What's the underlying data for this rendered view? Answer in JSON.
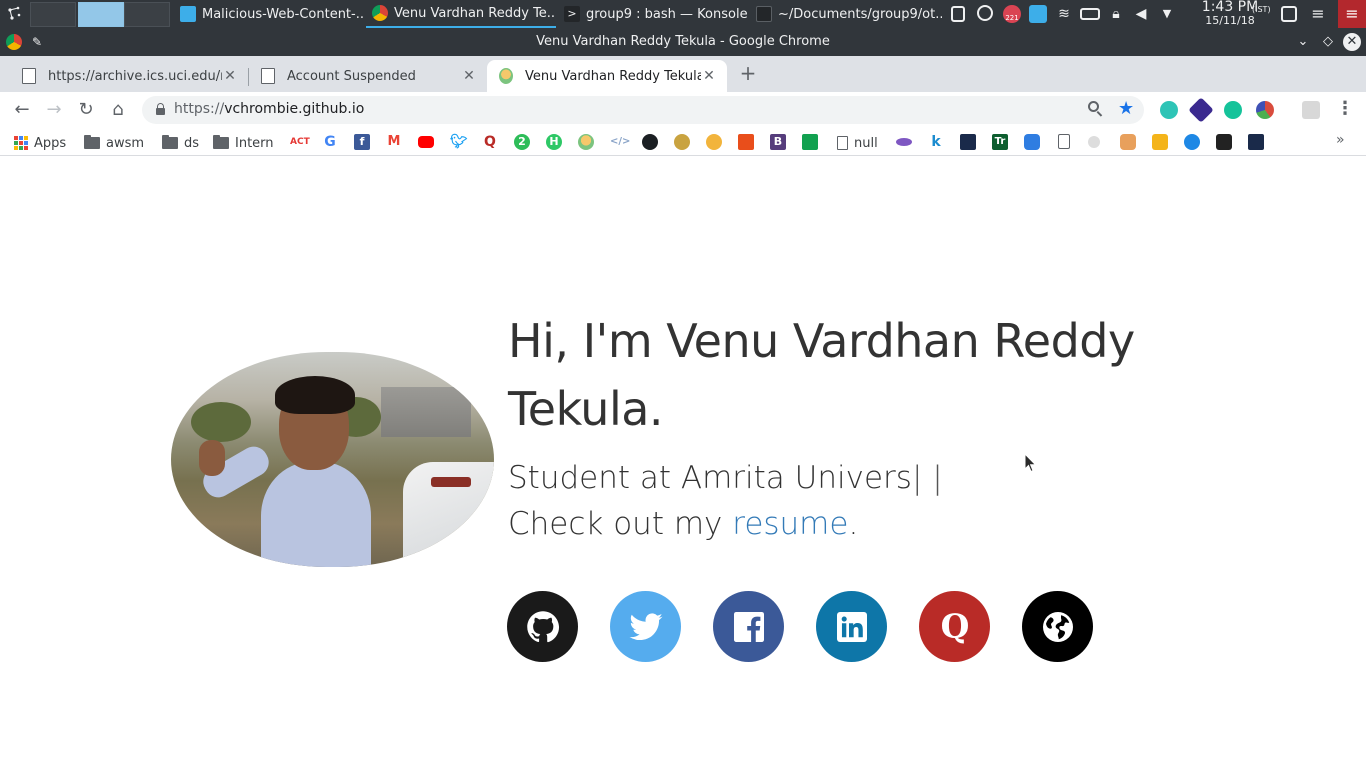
{
  "taskbar": {
    "tasks": [
      {
        "label": "Malicious-Web-Content-...",
        "icon": "folder-icon",
        "active": false
      },
      {
        "label": "Venu Vardhan Reddy Te...",
        "icon": "chrome-icon",
        "active": true
      },
      {
        "label": "group9 : bash — Konsole",
        "icon": "terminal-icon",
        "active": false
      },
      {
        "label": "~/Documents/group9/ot...",
        "icon": "editor-icon",
        "active": false
      }
    ],
    "clock": {
      "time": "1:43 PM",
      "zone": "(IST)",
      "date": "15/11/18"
    },
    "tray_badge": "221"
  },
  "window": {
    "title": "Venu Vardhan Reddy Tekula - Google Chrome"
  },
  "tabs": [
    {
      "label": "https://archive.ics.uci.edu/ml/...",
      "active": false
    },
    {
      "label": "Account Suspended",
      "active": false
    },
    {
      "label": "Venu Vardhan Reddy Tekula",
      "active": true
    }
  ],
  "omnibox": {
    "scheme": "https://",
    "host": "vchrombie.github.io"
  },
  "bookmarks": {
    "apps": "Apps",
    "folders": [
      "awsm",
      "ds",
      "Intern"
    ],
    "null_label": "null"
  },
  "hero": {
    "heading": "Hi, I'm Venu Vardhan Reddy Tekula.",
    "typed": "Student at Amrita Univers",
    "cursor": "| |",
    "resume_prefix": "Check out my ",
    "resume_link": "resume",
    "resume_suffix": "."
  },
  "socials": [
    {
      "name": "github",
      "color": "#1a1a1a"
    },
    {
      "name": "twitter",
      "color": "#55acee"
    },
    {
      "name": "facebook",
      "color": "#3b5998"
    },
    {
      "name": "linkedin",
      "color": "#0e76a8"
    },
    {
      "name": "quora",
      "color": "#b92b27"
    },
    {
      "name": "website",
      "color": "#000000"
    }
  ]
}
